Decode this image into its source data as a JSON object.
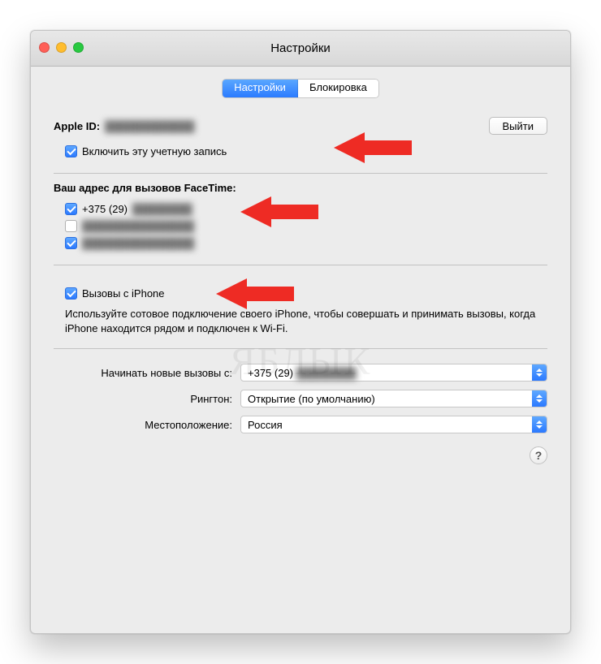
{
  "window": {
    "title": "Настройки"
  },
  "tabs": {
    "settings": "Настройки",
    "blocking": "Блокировка"
  },
  "appleid": {
    "label": "Apple ID:",
    "value": "████████████",
    "signout": "Выйти",
    "enable_checkbox": "Включить эту учетную запись"
  },
  "addresses": {
    "heading": "Ваш адрес для вызовов FaceTime:",
    "items": [
      {
        "label": "+375 (29)",
        "blurred": "████████",
        "checked": true
      },
      {
        "label": "",
        "blurred": "███████████████",
        "checked": false
      },
      {
        "label": "",
        "blurred": "███████████████",
        "checked": true
      }
    ]
  },
  "iphone": {
    "checkbox_label": "Вызовы с iPhone",
    "description": "Используйте сотовое подключение своего iPhone, чтобы совершать и принимать вызовы, когда iPhone находится рядом и подключен к Wi-Fi."
  },
  "form": {
    "startcalls": {
      "label": "Начинать новые вызовы с:",
      "prefix": "+375 (29)",
      "blurred": "████████"
    },
    "ringtone": {
      "label": "Рингтон:",
      "value": "Открытие (по умолчанию)"
    },
    "location": {
      "label": "Местоположение:",
      "value": "Россия"
    }
  },
  "help": "?",
  "watermark": "ЯБЛЫК"
}
